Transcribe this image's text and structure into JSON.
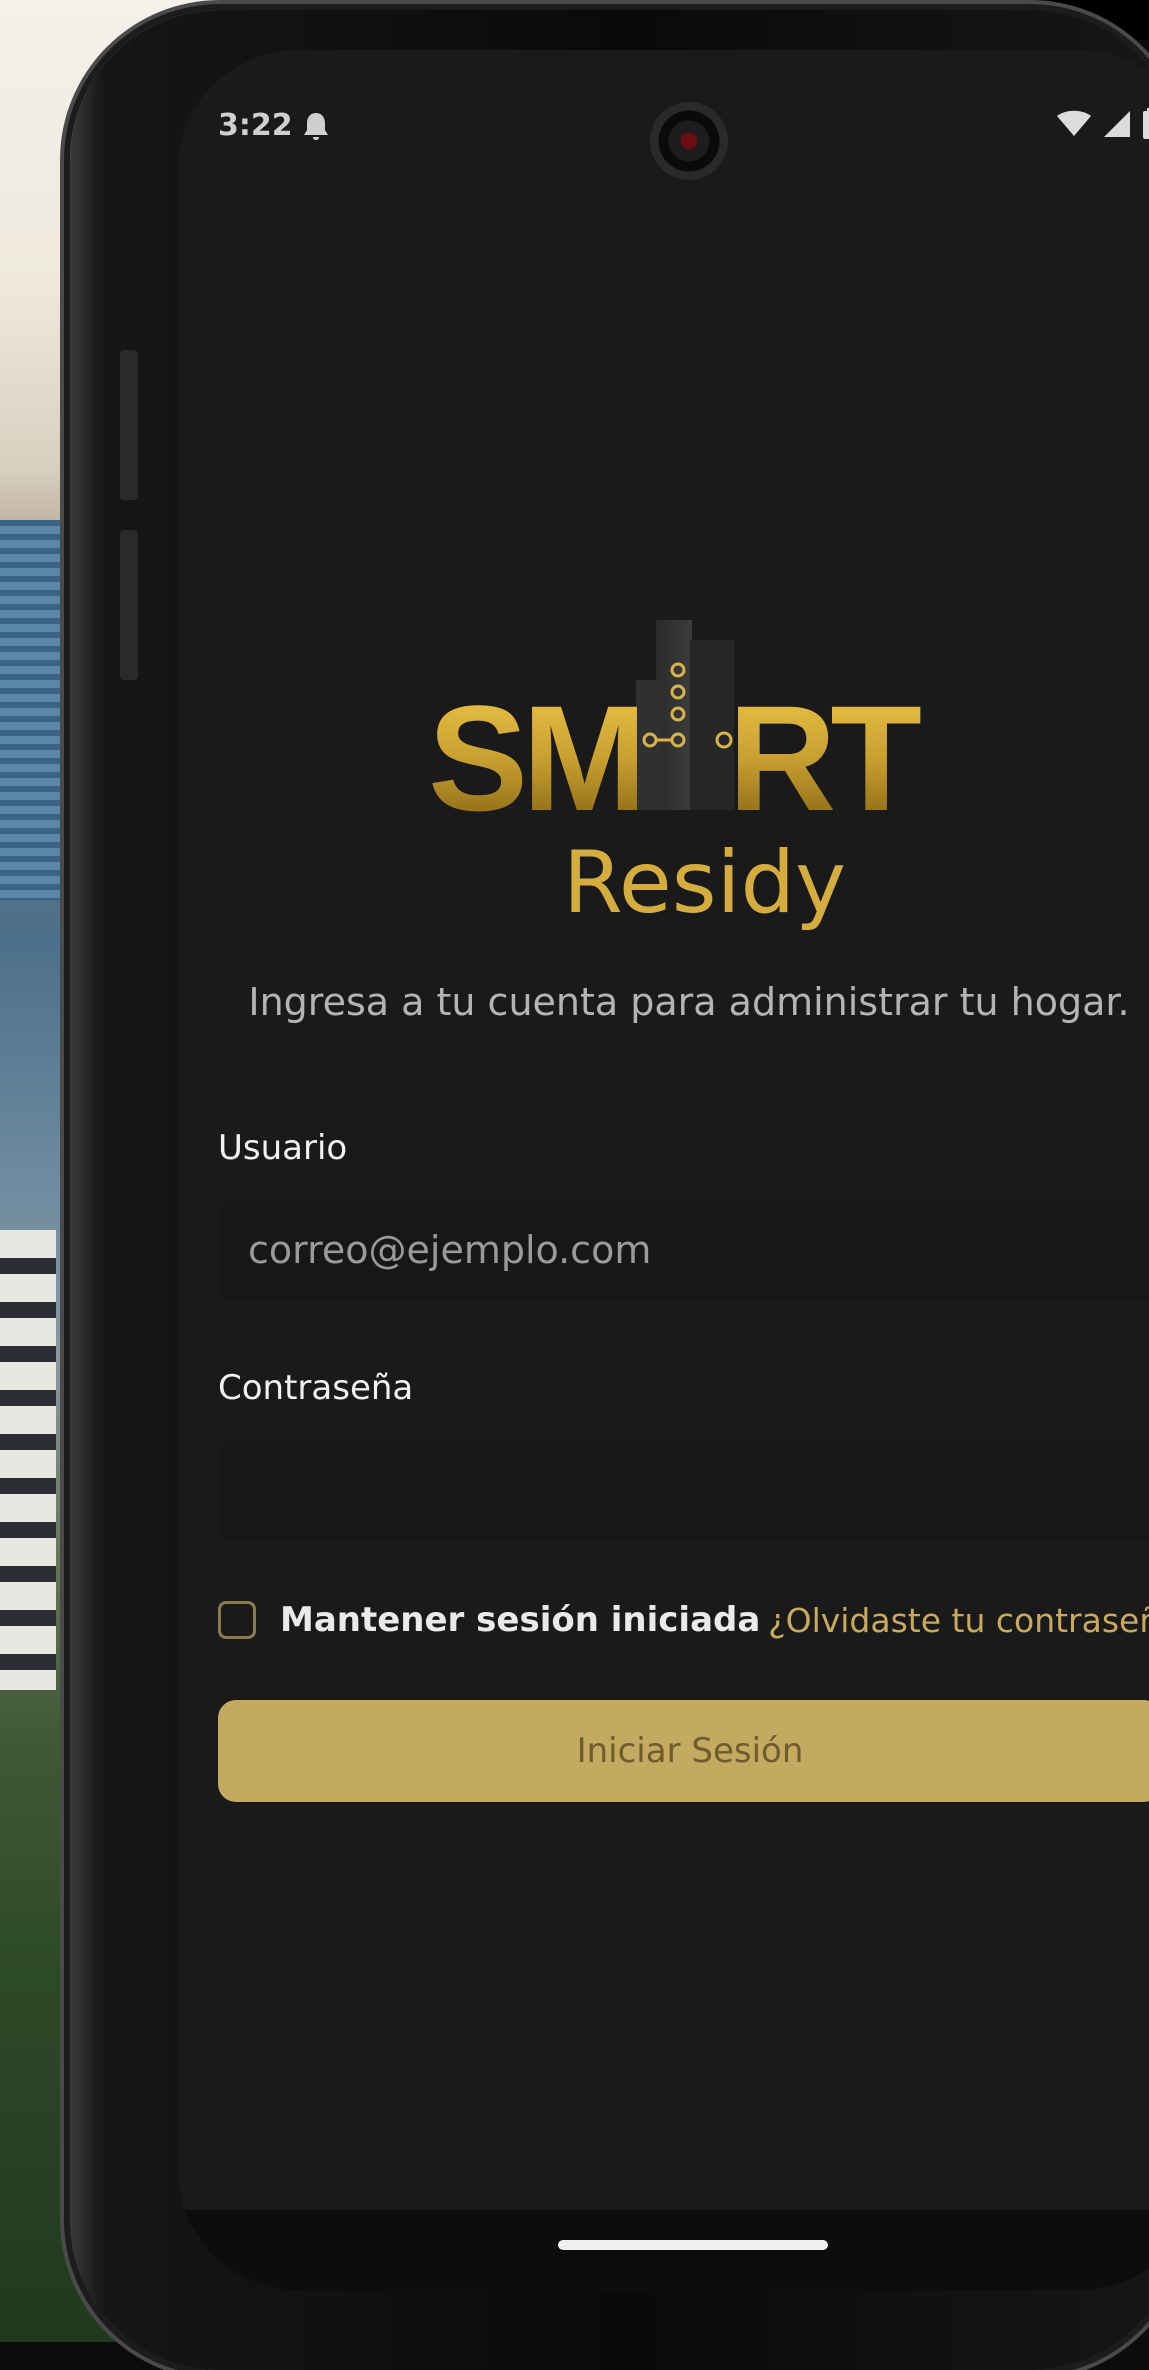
{
  "status_bar": {
    "time": "3:22",
    "signal_level": "full"
  },
  "app": {
    "logo_word_top": "SMART",
    "logo_word_bottom": "Residy",
    "brand_colors": {
      "gold": "#c9a95c",
      "gold_dark": "#8f6b14",
      "background": "#1a1a1a"
    }
  },
  "login": {
    "subtitle": "Ingresa a tu cuenta para administrar tu hogar.",
    "username_label": "Usuario",
    "username_placeholder": "correo@ejemplo.com",
    "username_value": "",
    "password_label": "Contraseña",
    "password_value": "",
    "remember_label": "Mantener sesión iniciada",
    "remember_checked": false,
    "forgot_link": "¿Olvidaste tu contraseña?",
    "submit_label": "Iniciar Sesión"
  },
  "icons": [
    "notification-icon",
    "wifi-icon",
    "signal-icon",
    "battery-icon",
    "front-camera-icon",
    "checkbox-icon"
  ]
}
